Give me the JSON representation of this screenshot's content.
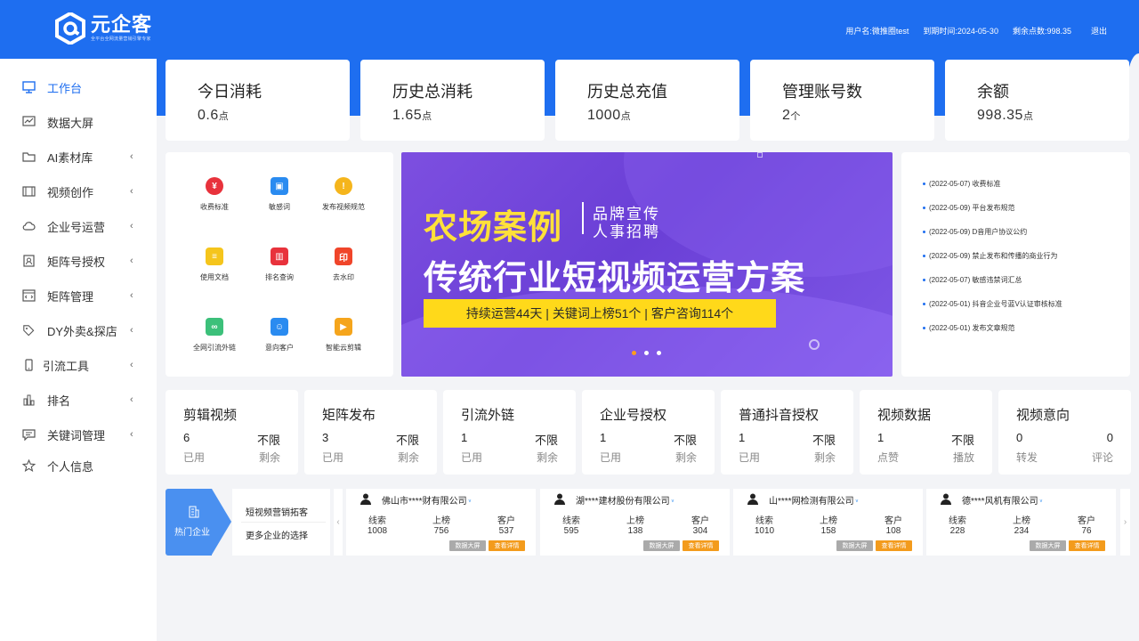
{
  "header": {
    "brand": "元企客",
    "brand_sub": "全平台全网流量营销引擎专家",
    "username": "用户名:微推圈test",
    "expire": "到期时间:2024-05-30",
    "points": "剩余点数:998.35",
    "logout": "退出"
  },
  "sidebar": {
    "items": [
      {
        "label": "工作台",
        "icon": "monitor-icon",
        "chevron": false
      },
      {
        "label": "数据大屏",
        "icon": "chart-screen-icon",
        "chevron": false
      },
      {
        "label": "AI素材库",
        "icon": "folder-icon",
        "chevron": true
      },
      {
        "label": "视频创作",
        "icon": "film-icon",
        "chevron": true
      },
      {
        "label": "企业号运营",
        "icon": "cloud-icon",
        "chevron": true
      },
      {
        "label": "矩阵号授权",
        "icon": "id-card-icon",
        "chevron": true
      },
      {
        "label": "矩阵管理",
        "icon": "code-window-icon",
        "chevron": true
      },
      {
        "label": "DY外卖&探店",
        "icon": "tag-icon",
        "chevron": true
      },
      {
        "label": "引流工具",
        "icon": "phone-icon",
        "chevron": true
      },
      {
        "label": "排名",
        "icon": "bar-chart-icon",
        "chevron": true
      },
      {
        "label": "关键词管理",
        "icon": "comment-icon",
        "chevron": true
      },
      {
        "label": "个人信息",
        "icon": "star-icon",
        "chevron": false
      }
    ],
    "chevron_glyph": "‹"
  },
  "stats": [
    {
      "title": "今日消耗",
      "value": "0.6",
      "unit": "点"
    },
    {
      "title": "历史总消耗",
      "value": "1.65",
      "unit": "点"
    },
    {
      "title": "历史总充值",
      "value": "1000",
      "unit": "点"
    },
    {
      "title": "管理账号数",
      "value": "2",
      "unit": "个"
    },
    {
      "title": "余额",
      "value": "998.35",
      "unit": "点"
    }
  ],
  "quick_links": [
    {
      "label": "收费标准",
      "color": "#e8323c",
      "glyph": "¥"
    },
    {
      "label": "敏感词",
      "color": "#2a8bf0",
      "glyph": "▣"
    },
    {
      "label": "发布视频规范",
      "color": "#f5b51c",
      "glyph": "!"
    },
    {
      "label": "使用文档",
      "color": "#f5c51c",
      "glyph": "≡"
    },
    {
      "label": "排名查询",
      "color": "#e8323c",
      "glyph": "▥"
    },
    {
      "label": "去水印",
      "color": "#f0452a",
      "glyph": "印"
    },
    {
      "label": "全网引流外链",
      "color": "#3cc07a",
      "glyph": "∞"
    },
    {
      "label": "意向客户",
      "color": "#2a8bf0",
      "glyph": "☺"
    },
    {
      "label": "智能云剪辑",
      "color": "#f5a51c",
      "glyph": "▶"
    }
  ],
  "banner": {
    "main": "农场案例",
    "side1": "品牌宣传",
    "side2": "人事招聘",
    "title": "传统行业短视频运营方案",
    "pill": "持续运营44天 | 关键词上榜51个 | 客户咨询114个"
  },
  "news": [
    "(2022-05-07) 收费标准",
    "(2022-05-09) 平台发布规范",
    "(2022-05-09) D音用户协议公约",
    "(2022-05-09) 禁止发布和传播的商业行为",
    "(2022-05-07) 敏感违禁词汇总",
    "(2022-05-01) 抖音企业号蓝V认证审核标准",
    "(2022-05-01) 发布文章规范"
  ],
  "functions": [
    {
      "title": "剪辑视频",
      "v1": "6",
      "v2": "不限",
      "l1": "已用",
      "l2": "剩余"
    },
    {
      "title": "矩阵发布",
      "v1": "3",
      "v2": "不限",
      "l1": "已用",
      "l2": "剩余"
    },
    {
      "title": "引流外链",
      "v1": "1",
      "v2": "不限",
      "l1": "已用",
      "l2": "剩余"
    },
    {
      "title": "企业号授权",
      "v1": "1",
      "v2": "不限",
      "l1": "已用",
      "l2": "剩余"
    },
    {
      "title": "普通抖音授权",
      "v1": "1",
      "v2": "不限",
      "l1": "已用",
      "l2": "剩余"
    },
    {
      "title": "视频数据",
      "v1": "1",
      "v2": "不限",
      "l1": "点赞",
      "l2": "播放"
    },
    {
      "title": "视频意向",
      "v1": "0",
      "v2": "0",
      "l1": "转发",
      "l2": "评论"
    }
  ],
  "hot": {
    "tag": "热门企业",
    "line1": "短视频营销拓客",
    "line2": "更多企业的选择",
    "prev": "‹",
    "next": "›"
  },
  "companies": [
    {
      "name": "佛山市****财有限公司",
      "leads": "1008",
      "rank": "756",
      "clients": "537"
    },
    {
      "name": "湖****建材股份有限公司",
      "leads": "595",
      "rank": "138",
      "clients": "304"
    },
    {
      "name": "山****网检测有限公司",
      "leads": "1010",
      "rank": "158",
      "clients": "108"
    },
    {
      "name": "德****风机有限公司",
      "leads": "228",
      "rank": "234",
      "clients": "76"
    }
  ],
  "company_labels": {
    "leads": "线索",
    "rank": "上榜",
    "clients": "客户",
    "btn_screen": "数据大屏",
    "btn_detail": "查看详情",
    "verify": "ᵛ"
  }
}
